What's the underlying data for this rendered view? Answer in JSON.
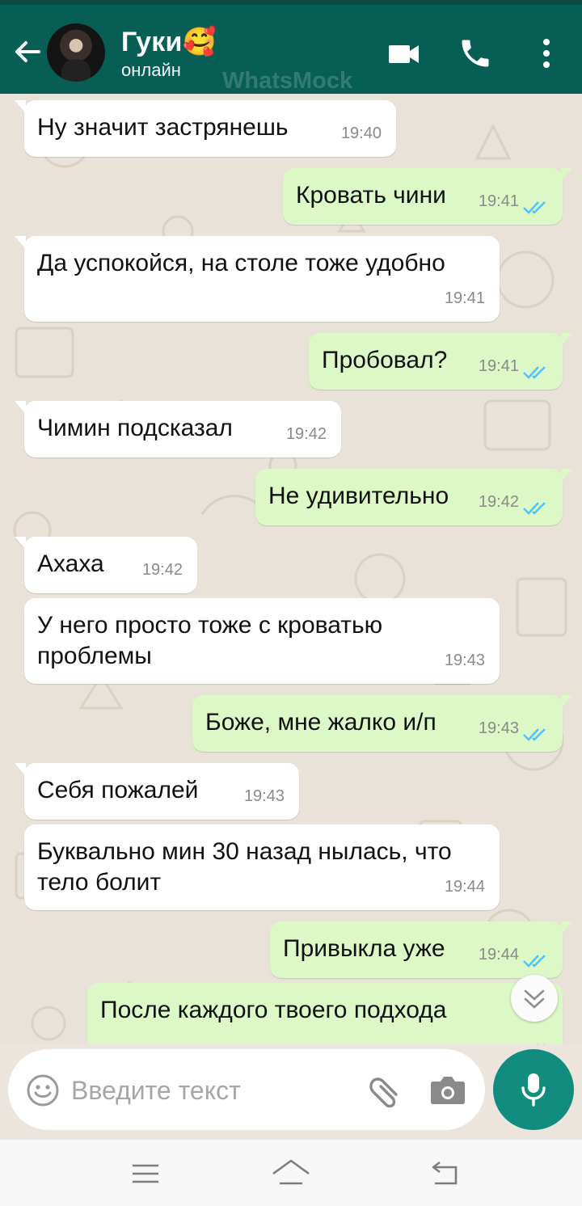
{
  "header": {
    "contact_name": "Гуки🥰",
    "status": "онлайн",
    "watermark": "WhatsMock",
    "bg_color": "#075e54"
  },
  "messages": [
    {
      "dir": "in",
      "text": "Ну значит застрянешь",
      "time": "19:40"
    },
    {
      "dir": "out",
      "text": "Кровать чини",
      "time": "19:41",
      "status": "read"
    },
    {
      "dir": "in",
      "text": "Да успокойся, на столе тоже удобно",
      "time": "19:41"
    },
    {
      "dir": "out",
      "text": "Пробовал?",
      "time": "19:41",
      "status": "read"
    },
    {
      "dir": "in",
      "text": "Чимин подсказал",
      "time": "19:42"
    },
    {
      "dir": "out",
      "text": "Не удивительно",
      "time": "19:42",
      "status": "read"
    },
    {
      "dir": "in",
      "text": "Ахаха",
      "time": "19:42"
    },
    {
      "dir": "in",
      "text": "У него просто тоже с кроватью проблемы",
      "time": "19:43"
    },
    {
      "dir": "out",
      "text": "Боже, мне жалко и/п",
      "time": "19:43",
      "status": "read"
    },
    {
      "dir": "in",
      "text": "Себя пожалей",
      "time": "19:43"
    },
    {
      "dir": "in",
      "text": "Буквально мин 30 назад нылась, что тело болит",
      "time": "19:44"
    },
    {
      "dir": "out",
      "text": "Привыкла уже",
      "time": "19:44",
      "status": "read"
    },
    {
      "dir": "out",
      "text": "После каждого твоего подхода",
      "time": "",
      "status": "read"
    }
  ],
  "composer": {
    "placeholder": "Введите текст"
  },
  "icons": {
    "back": "back-arrow-icon",
    "video": "video-camera-icon",
    "call": "phone-icon",
    "menu": "more-vertical-icon",
    "emoji": "emoji-icon",
    "attach": "paperclip-icon",
    "camera": "camera-icon",
    "mic": "microphone-icon",
    "scroll": "chevron-down-icon"
  },
  "colors": {
    "incoming_bubble": "#ffffff",
    "outgoing_bubble": "#dcf8c6",
    "read_ticks": "#4fc3f7",
    "mic_button": "#128c7e"
  }
}
